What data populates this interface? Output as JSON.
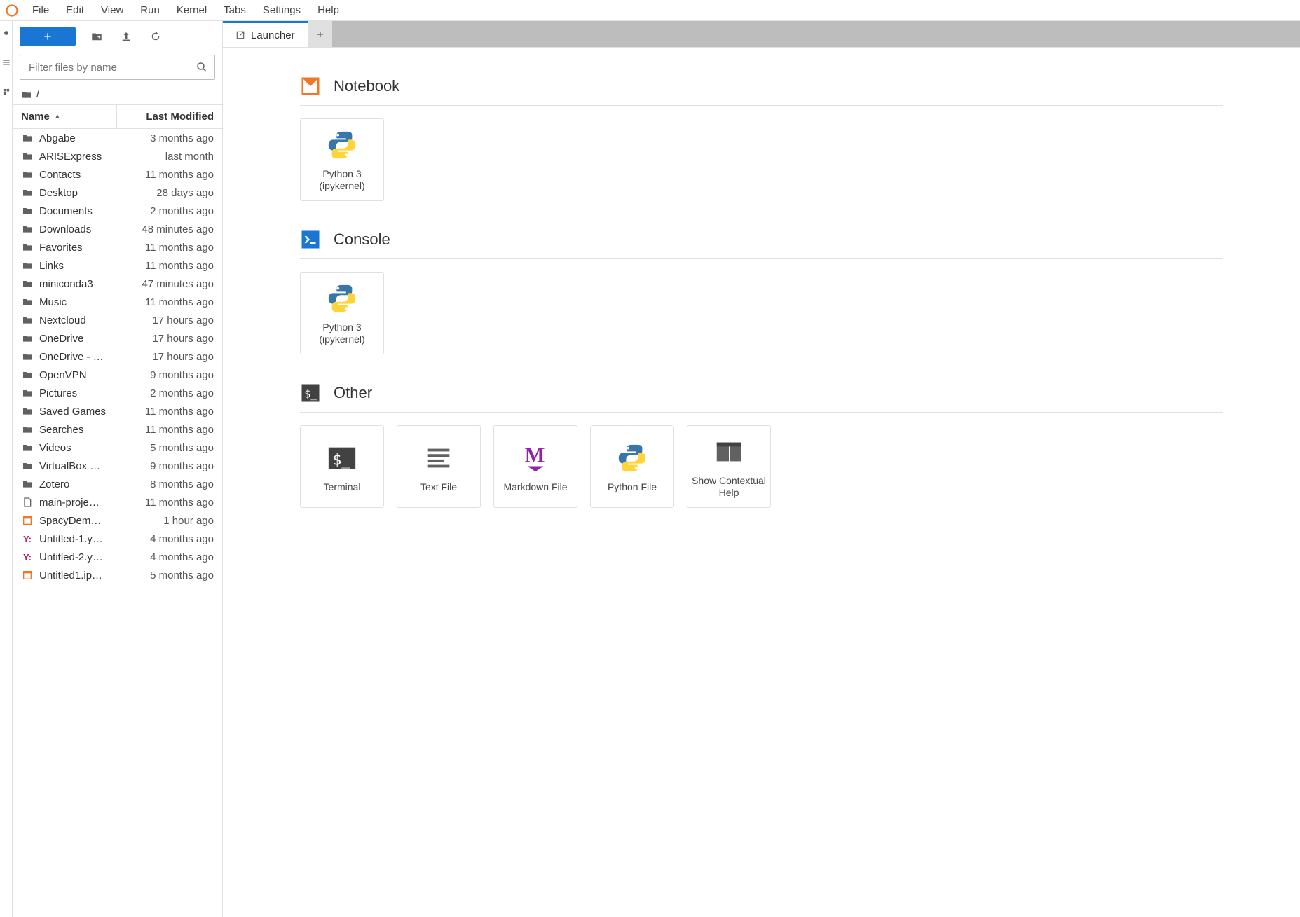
{
  "menu": [
    "File",
    "Edit",
    "View",
    "Run",
    "Kernel",
    "Tabs",
    "Settings",
    "Help"
  ],
  "sidebar": {
    "filter_placeholder": "Filter files by name",
    "breadcrumb_root": "/",
    "columns": {
      "name": "Name",
      "modified": "Last Modified"
    },
    "items": [
      {
        "type": "folder",
        "name": "Abgabe",
        "modified": "3 months ago"
      },
      {
        "type": "folder",
        "name": "ARISExpress",
        "modified": "last month"
      },
      {
        "type": "folder",
        "name": "Contacts",
        "modified": "11 months ago"
      },
      {
        "type": "folder",
        "name": "Desktop",
        "modified": "28 days ago"
      },
      {
        "type": "folder",
        "name": "Documents",
        "modified": "2 months ago"
      },
      {
        "type": "folder",
        "name": "Downloads",
        "modified": "48 minutes ago"
      },
      {
        "type": "folder",
        "name": "Favorites",
        "modified": "11 months ago"
      },
      {
        "type": "folder",
        "name": "Links",
        "modified": "11 months ago"
      },
      {
        "type": "folder",
        "name": "miniconda3",
        "modified": "47 minutes ago"
      },
      {
        "type": "folder",
        "name": "Music",
        "modified": "11 months ago"
      },
      {
        "type": "folder",
        "name": "Nextcloud",
        "modified": "17 hours ago"
      },
      {
        "type": "folder",
        "name": "OneDrive",
        "modified": "17 hours ago"
      },
      {
        "type": "folder",
        "name": "OneDrive - …",
        "modified": "17 hours ago"
      },
      {
        "type": "folder",
        "name": "OpenVPN",
        "modified": "9 months ago"
      },
      {
        "type": "folder",
        "name": "Pictures",
        "modified": "2 months ago"
      },
      {
        "type": "folder",
        "name": "Saved Games",
        "modified": "11 months ago"
      },
      {
        "type": "folder",
        "name": "Searches",
        "modified": "11 months ago"
      },
      {
        "type": "folder",
        "name": "Videos",
        "modified": "5 months ago"
      },
      {
        "type": "folder",
        "name": "VirtualBox …",
        "modified": "9 months ago"
      },
      {
        "type": "folder",
        "name": "Zotero",
        "modified": "8 months ago"
      },
      {
        "type": "file",
        "name": "main-proje…",
        "modified": "11 months ago"
      },
      {
        "type": "notebook",
        "name": "SpacyDem…",
        "modified": "1 hour ago"
      },
      {
        "type": "yaml",
        "name": "Untitled-1.y…",
        "modified": "4 months ago"
      },
      {
        "type": "yaml",
        "name": "Untitled-2.y…",
        "modified": "4 months ago"
      },
      {
        "type": "notebook",
        "name": "Untitled1.ip…",
        "modified": "5 months ago"
      }
    ]
  },
  "tabs": {
    "active": "Launcher"
  },
  "launcher": {
    "sections": [
      {
        "id": "notebook",
        "title": "Notebook",
        "icon": "notebook",
        "cards": [
          {
            "icon": "python",
            "label": "Python 3\n(ipykernel)"
          }
        ]
      },
      {
        "id": "console",
        "title": "Console",
        "icon": "console",
        "cards": [
          {
            "icon": "python",
            "label": "Python 3\n(ipykernel)"
          }
        ]
      },
      {
        "id": "other",
        "title": "Other",
        "icon": "terminal",
        "cards": [
          {
            "icon": "terminal",
            "label": "Terminal"
          },
          {
            "icon": "textfile",
            "label": "Text File"
          },
          {
            "icon": "markdown",
            "label": "Markdown File"
          },
          {
            "icon": "python",
            "label": "Python File"
          },
          {
            "icon": "help",
            "label": "Show Contextual\nHelp"
          }
        ]
      }
    ]
  }
}
